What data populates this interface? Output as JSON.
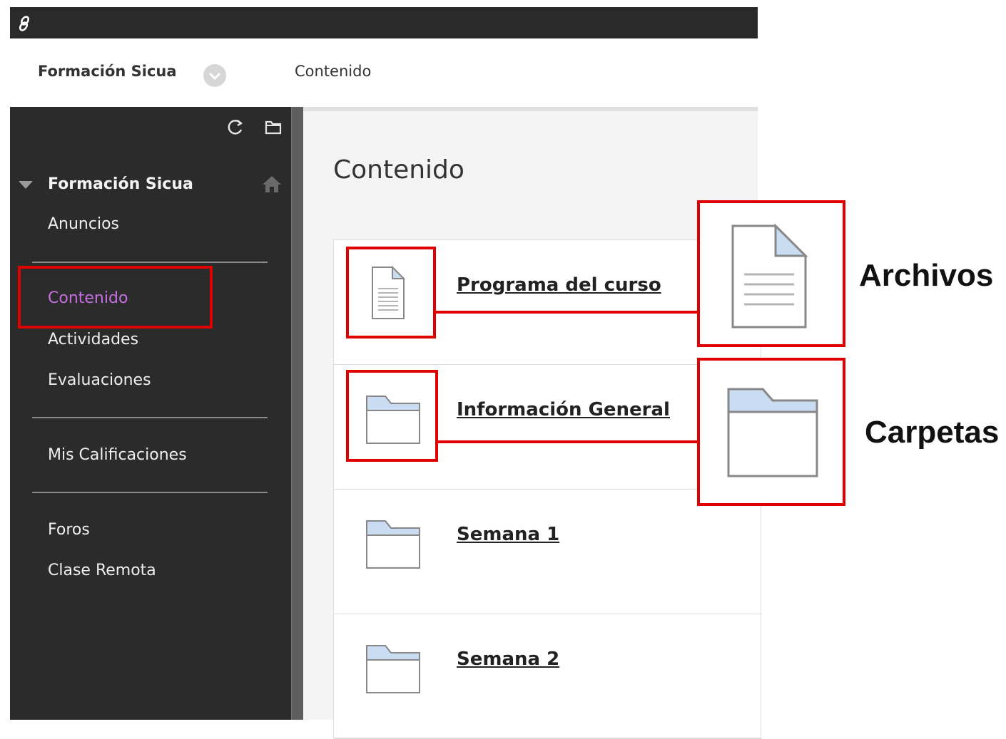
{
  "breadcrumb": {
    "course": "Formación Sicua",
    "page": "Contenido"
  },
  "sidebar": {
    "course_title": "Formación Sicua",
    "items": [
      {
        "label": "Anuncios",
        "active": false
      },
      {
        "label": "Contenido",
        "active": true
      },
      {
        "label": "Actividades",
        "active": false
      },
      {
        "label": "Evaluaciones",
        "active": false
      },
      {
        "label": "Mis Calificaciones",
        "active": false
      },
      {
        "label": "Foros",
        "active": false
      },
      {
        "label": "Clase Remota",
        "active": false
      }
    ],
    "tools": [
      "refresh-icon",
      "folder-icon"
    ]
  },
  "main": {
    "title": "Contenido",
    "items": [
      {
        "title": "Programa del curso",
        "type": "file",
        "icon": "file-icon"
      },
      {
        "title": "Información General",
        "type": "folder",
        "icon": "folder-icon"
      },
      {
        "title": "Semana 1",
        "type": "folder",
        "icon": "folder-icon"
      },
      {
        "title": "Semana 2",
        "type": "folder",
        "icon": "folder-icon"
      }
    ]
  },
  "annotations": {
    "files_label": "Archivos",
    "folders_label": "Carpetas",
    "color": "#e00000"
  },
  "colors": {
    "topbar": "#2a2a2a",
    "sidebar": "#2b2b2b",
    "active_item": "#c46ee0"
  }
}
